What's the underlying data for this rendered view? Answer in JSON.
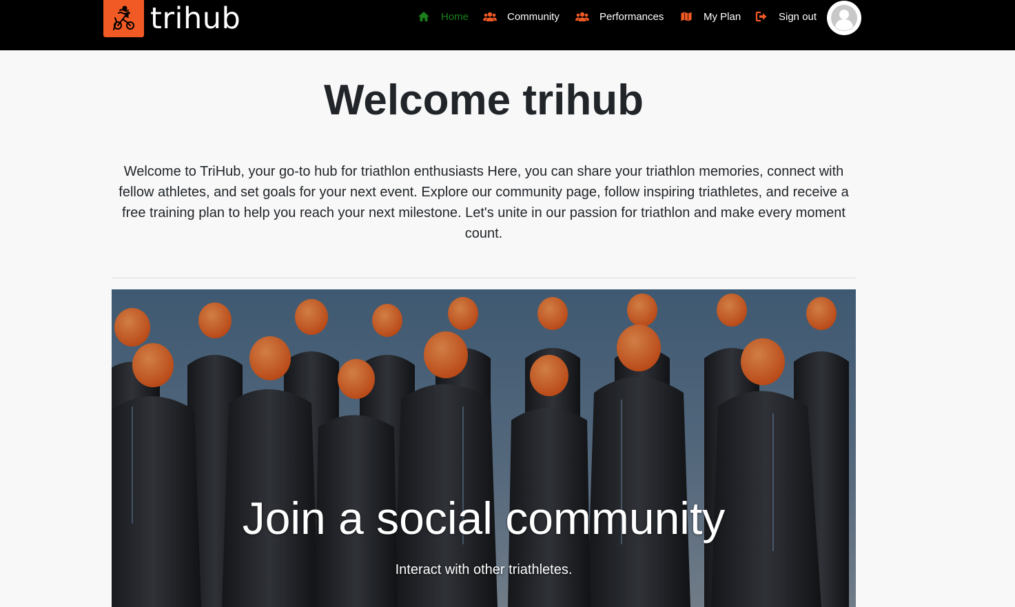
{
  "brand": {
    "name": "trihub",
    "logo_icon": "triathlon-logo-icon",
    "accent_color": "#f15a24"
  },
  "nav": {
    "items": [
      {
        "label": "Home",
        "icon": "home-icon",
        "active": true,
        "color": "#1a7f1a"
      },
      {
        "label": "Community",
        "icon": "users-icon",
        "active": false
      },
      {
        "label": "Performances",
        "icon": "users-icon",
        "active": false
      },
      {
        "label": "My Plan",
        "icon": "map-icon",
        "active": false
      },
      {
        "label": "Sign out",
        "icon": "sign-out-icon",
        "active": false
      }
    ],
    "icon_color": "#f15a24",
    "avatar_icon": "user-avatar-icon"
  },
  "main": {
    "title": "Welcome trihub",
    "intro": "Welcome to TriHub, your go-to hub for triathlon enthusiasts Here, you can share your triathlon memories, connect with fellow athletes, and set goals for your next event. Explore our community page, follow inspiring triathletes, and receive a free training plan to help you reach your next milestone. Let's unite in our passion for triathlon and make every moment count."
  },
  "hero": {
    "title": "Join a social community",
    "subtitle": "Interact with other triathletes."
  }
}
